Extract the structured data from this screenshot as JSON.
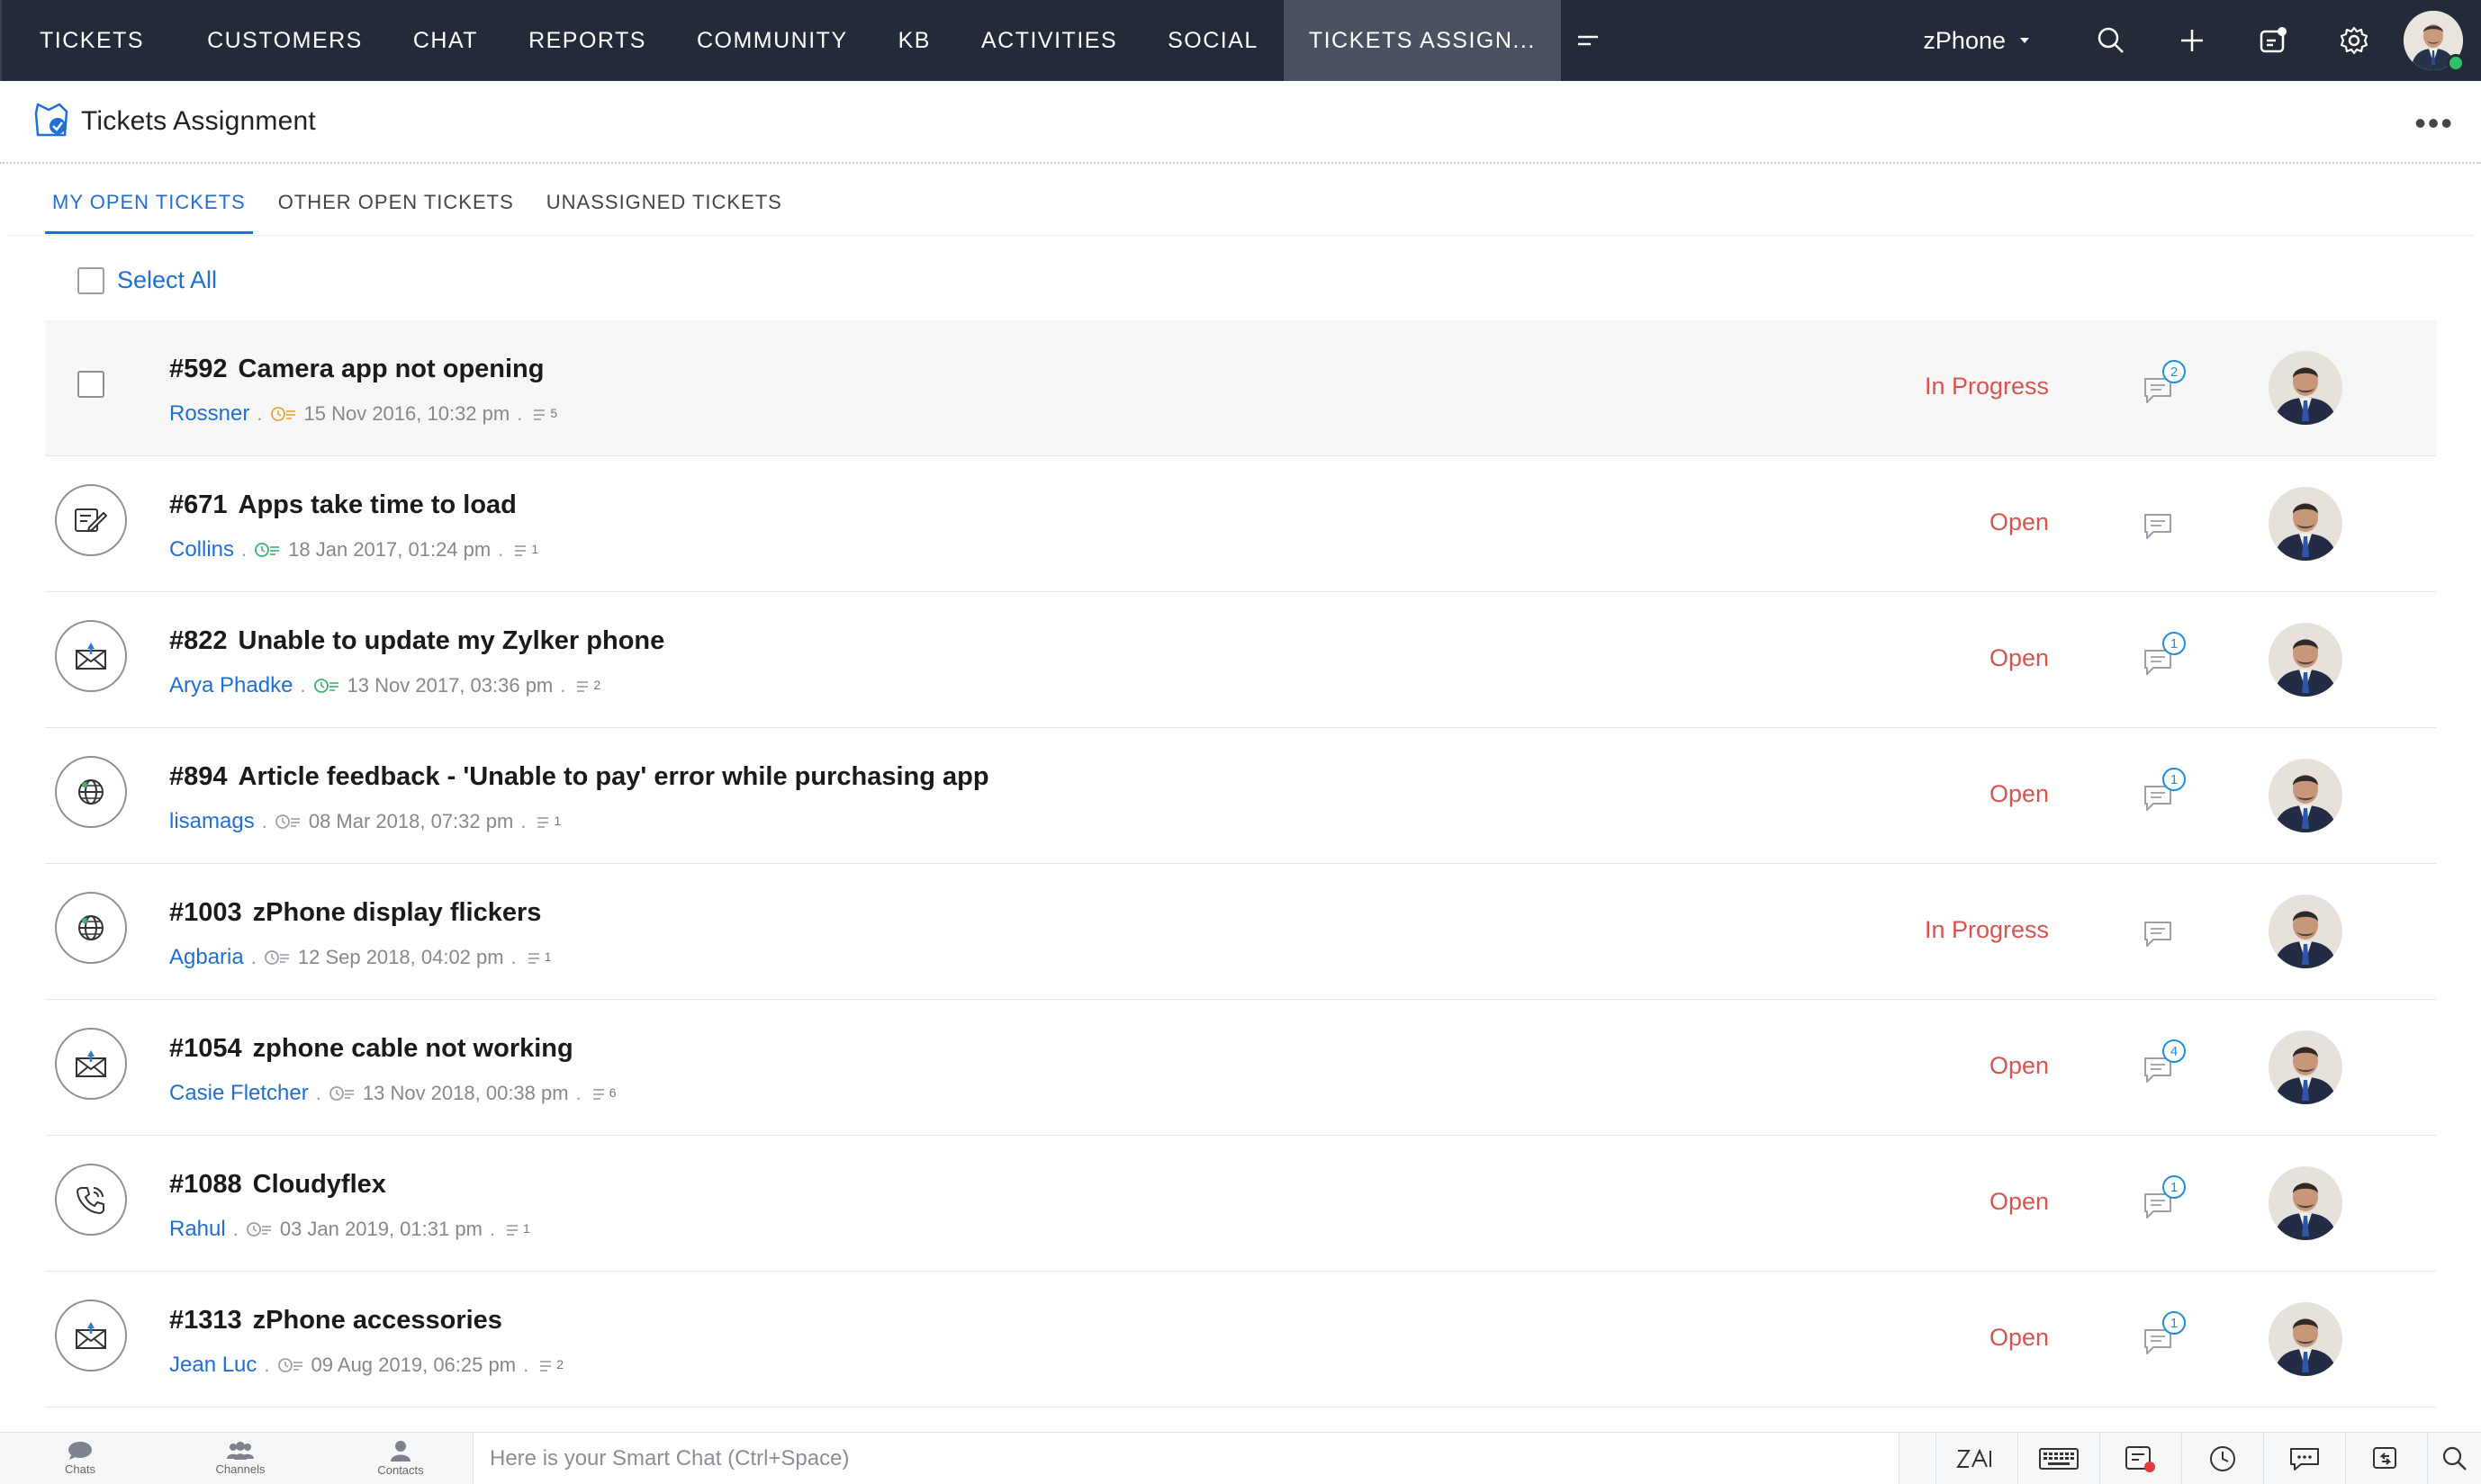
{
  "nav": {
    "items": [
      "Tickets",
      "Customers",
      "Chat",
      "Reports",
      "Community",
      "KB",
      "Activities",
      "Social",
      "Tickets Assign..."
    ],
    "active_index": 8,
    "department": "zPhone"
  },
  "header": {
    "title": "Tickets Assignment"
  },
  "tabs": [
    {
      "label": "My Open Tickets",
      "active": true
    },
    {
      "label": "Other Open Tickets",
      "active": false
    },
    {
      "label": "Unassigned Tickets",
      "active": false
    }
  ],
  "select_all_label": "Select All",
  "tickets": [
    {
      "id": "#592",
      "subject": "Camera app not opening",
      "contact": "Rossner",
      "date": "15 Nov 2016, 10:32 pm",
      "threads": "5",
      "status": "In Progress",
      "comments": "2",
      "channel": "checkbox",
      "clock_color": "#e8a33d"
    },
    {
      "id": "#671",
      "subject": "Apps take time to load",
      "contact": "Collins",
      "date": "18 Jan 2017, 01:24 pm",
      "threads": "1",
      "status": "Open",
      "comments": "",
      "channel": "web-form-icon",
      "clock_color": "#3cb371"
    },
    {
      "id": "#822",
      "subject": "Unable to update my Zylker phone",
      "contact": "Arya Phadke",
      "date": "13 Nov 2017, 03:36 pm",
      "threads": "2",
      "status": "Open",
      "comments": "1",
      "channel": "email-icon",
      "clock_color": "#3cb371"
    },
    {
      "id": "#894",
      "subject": "Article feedback - 'Unable to pay' error while purchasing app",
      "contact": "lisamags",
      "date": "08 Mar 2018, 07:32 pm",
      "threads": "1",
      "status": "Open",
      "comments": "1",
      "channel": "web-icon",
      "clock_color": "#9aa0a8"
    },
    {
      "id": "#1003",
      "subject": "zPhone display flickers",
      "contact": "Agbaria",
      "date": "12 Sep 2018, 04:02 pm",
      "threads": "1",
      "status": "In Progress",
      "comments": "",
      "channel": "web-icon",
      "clock_color": "#9aa0a8"
    },
    {
      "id": "#1054",
      "subject": "zphone cable not working",
      "contact": "Casie Fletcher",
      "date": "13 Nov 2018, 00:38 pm",
      "threads": "6",
      "status": "Open",
      "comments": "4",
      "channel": "email-icon",
      "clock_color": "#9aa0a8"
    },
    {
      "id": "#1088",
      "subject": "Cloudyflex",
      "contact": "Rahul",
      "date": "03 Jan 2019, 01:31 pm",
      "threads": "1",
      "status": "Open",
      "comments": "1",
      "channel": "phone-icon",
      "clock_color": "#9aa0a8"
    },
    {
      "id": "#1313",
      "subject": "zPhone accessories",
      "contact": "Jean Luc",
      "date": "09 Aug 2019, 06:25 pm",
      "threads": "2",
      "status": "Open",
      "comments": "1",
      "channel": "email-icon",
      "clock_color": "#9aa0a8"
    }
  ],
  "bottom": {
    "tabs": [
      "Chats",
      "Channels",
      "Contacts"
    ],
    "smart_chat_placeholder": "Here is your Smart Chat (Ctrl+Space)"
  },
  "colors": {
    "nav_bg": "#232b38",
    "accent": "#1f6fd6",
    "status_red": "#d9534f",
    "badge_blue": "#1f8fe0"
  }
}
